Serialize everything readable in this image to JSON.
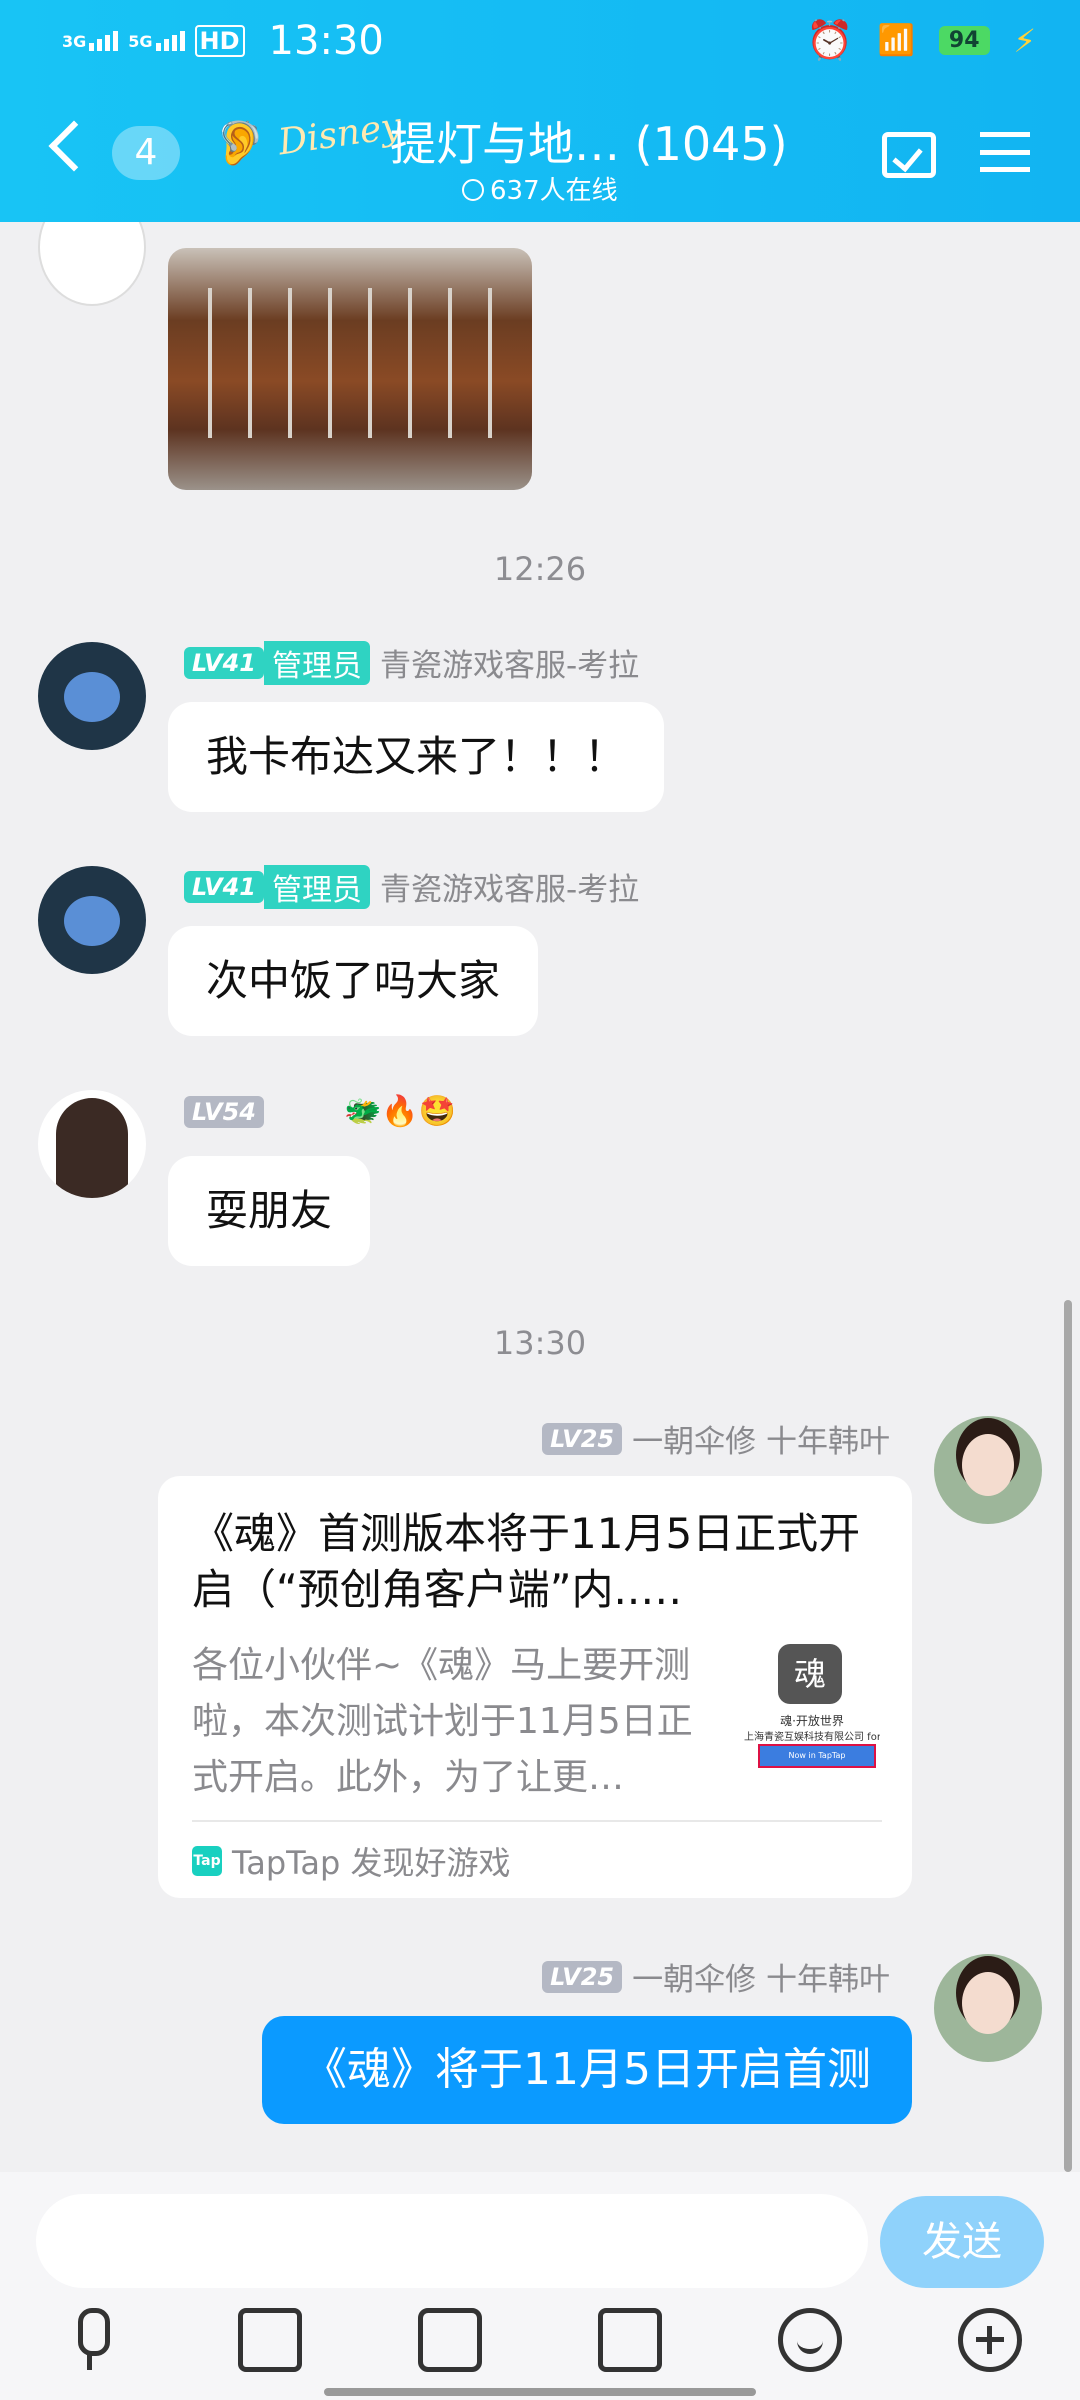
{
  "status_bar": {
    "network1": "3G",
    "network2": "5G",
    "hd": "HD",
    "time": "13:30",
    "battery": "94"
  },
  "header": {
    "unread_count": "4",
    "group_logo_text": "Disney",
    "group_title": "提灯与地… (1045)",
    "online_text": "637人在线"
  },
  "messages": [
    {
      "type": "image",
      "description_icon": "kebab-photo"
    },
    {
      "type": "time",
      "text": "12:26"
    },
    {
      "type": "text",
      "level": "LV41",
      "role": "管理员",
      "sender": "青瓷游戏客服-考拉",
      "text": "我卡布达又来了！！！"
    },
    {
      "type": "text",
      "level": "LV41",
      "role": "管理员",
      "sender": "青瓷游戏客服-考拉",
      "text": "次中饭了吗大家"
    },
    {
      "type": "text",
      "level": "LV54",
      "sender_emojis": "🐲🔥🤩",
      "text": "耍朋友"
    },
    {
      "type": "time",
      "text": "13:30"
    },
    {
      "type": "card",
      "level": "LV25",
      "sender": "一朝伞修 十年韩叶",
      "title": "《魂》首测版本将于11月5日正式开启（“预创角客户端”内..…",
      "description": "各位小伙伴~《魂》马上要开测啦，本次测试计划于11月5日正式开启。此外，为了让更…",
      "thumb_logo": "魂",
      "thumb_line1": "魂·开放世界",
      "thumb_line2": "上海青瓷互娱科技有限公司 for i",
      "thumb_button": "Now in TapTap",
      "source_icon": "Tap",
      "source": "TapTap 发现好游戏"
    },
    {
      "type": "text",
      "level": "LV25",
      "sender": "一朝伞修 十年韩叶",
      "text": "《魂》将于11月5日开启首测"
    }
  ],
  "input": {
    "placeholder": "",
    "send_label": "发送"
  },
  "toolbar": [
    "microphone-icon",
    "image-icon",
    "camera-icon",
    "red-packet-icon",
    "emoji-icon",
    "plus-icon"
  ],
  "colors": {
    "header": "#18c4f5",
    "self_bubble": "#0b9aff",
    "level_badge_admin": "#2fd3c2",
    "send_button": "#8fd2fb"
  }
}
